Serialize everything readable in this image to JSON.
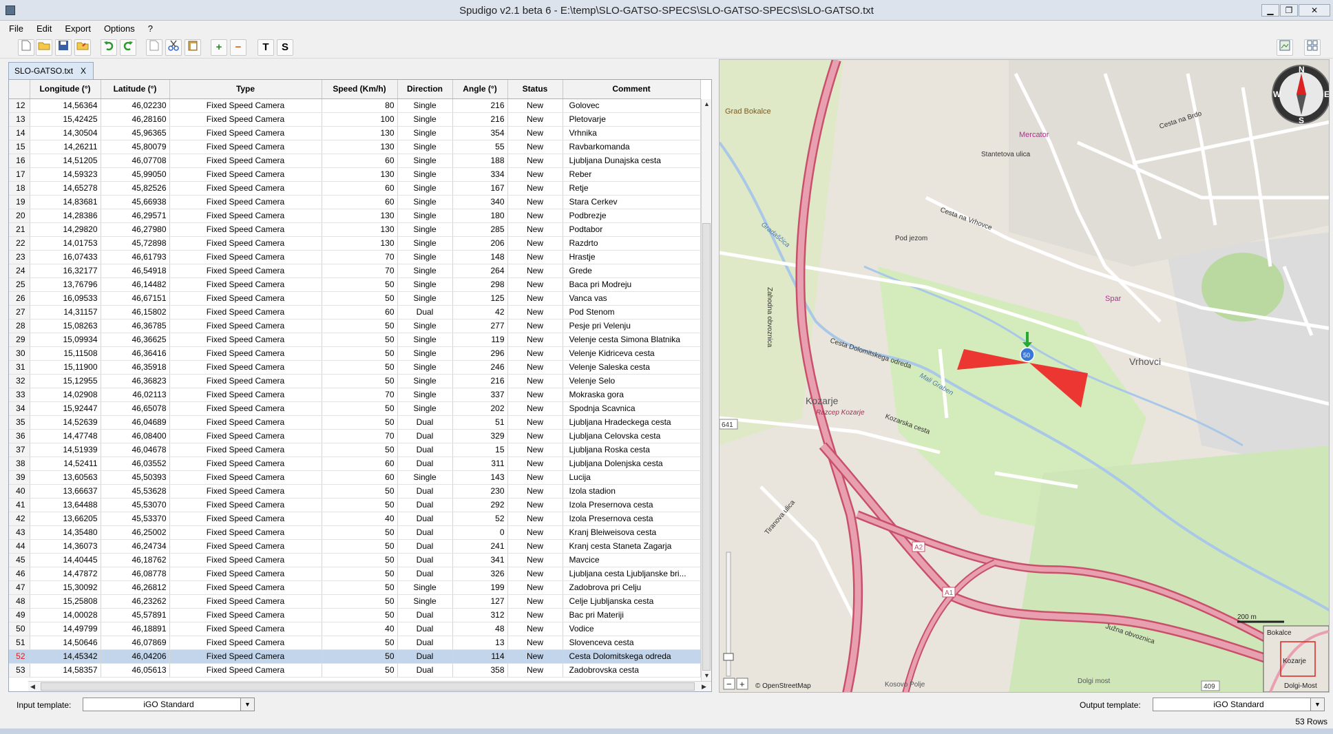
{
  "window": {
    "title": "Spudigo v2.1 beta 6 - E:\\temp\\SLO-GATSO-SPECS\\SLO-GATSO-SPECS\\SLO-GATSO.txt",
    "minimize": "▁",
    "maximize": "❐",
    "close": "✕"
  },
  "menu": [
    "File",
    "Edit",
    "Export",
    "Options",
    "?"
  ],
  "toolbar": {
    "text_tool": "T",
    "speed_tool": "S",
    "add": "+",
    "remove": "−"
  },
  "tab": {
    "label": "SLO-GATSO.txt",
    "close": "X"
  },
  "table": {
    "columns": [
      "",
      "Longitude (°)",
      "Latitude (°)",
      "Type",
      "Speed (Km/h)",
      "Direction",
      "Angle (°)",
      "Status",
      "Comment"
    ],
    "rows": [
      [
        "12",
        "14,56364",
        "46,02230",
        "Fixed Speed Camera",
        "80",
        "Single",
        "216",
        "New",
        "Golovec"
      ],
      [
        "13",
        "15,42425",
        "46,28160",
        "Fixed Speed Camera",
        "100",
        "Single",
        "216",
        "New",
        "Pletovarje"
      ],
      [
        "14",
        "14,30504",
        "45,96365",
        "Fixed Speed Camera",
        "130",
        "Single",
        "354",
        "New",
        "Vrhnika"
      ],
      [
        "15",
        "14,26211",
        "45,80079",
        "Fixed Speed Camera",
        "130",
        "Single",
        "55",
        "New",
        "Ravbarkomanda"
      ],
      [
        "16",
        "14,51205",
        "46,07708",
        "Fixed Speed Camera",
        "60",
        "Single",
        "188",
        "New",
        "Ljubljana Dunajska cesta"
      ],
      [
        "17",
        "14,59323",
        "45,99050",
        "Fixed Speed Camera",
        "130",
        "Single",
        "334",
        "New",
        "Reber"
      ],
      [
        "18",
        "14,65278",
        "45,82526",
        "Fixed Speed Camera",
        "60",
        "Single",
        "167",
        "New",
        "Retje"
      ],
      [
        "19",
        "14,83681",
        "45,66938",
        "Fixed Speed Camera",
        "60",
        "Single",
        "340",
        "New",
        "Stara Cerkev"
      ],
      [
        "20",
        "14,28386",
        "46,29571",
        "Fixed Speed Camera",
        "130",
        "Single",
        "180",
        "New",
        "Podbrezje"
      ],
      [
        "21",
        "14,29820",
        "46,27980",
        "Fixed Speed Camera",
        "130",
        "Single",
        "285",
        "New",
        "Podtabor"
      ],
      [
        "22",
        "14,01753",
        "45,72898",
        "Fixed Speed Camera",
        "130",
        "Single",
        "206",
        "New",
        "Razdrto"
      ],
      [
        "23",
        "16,07433",
        "46,61793",
        "Fixed Speed Camera",
        "70",
        "Single",
        "148",
        "New",
        "Hrastje"
      ],
      [
        "24",
        "16,32177",
        "46,54918",
        "Fixed Speed Camera",
        "70",
        "Single",
        "264",
        "New",
        "Grede"
      ],
      [
        "25",
        "13,76796",
        "46,14482",
        "Fixed Speed Camera",
        "50",
        "Single",
        "298",
        "New",
        "Baca pri Modreju"
      ],
      [
        "26",
        "16,09533",
        "46,67151",
        "Fixed Speed Camera",
        "50",
        "Single",
        "125",
        "New",
        "Vanca vas"
      ],
      [
        "27",
        "14,31157",
        "46,15802",
        "Fixed Speed Camera",
        "60",
        "Dual",
        "42",
        "New",
        "Pod Stenom"
      ],
      [
        "28",
        "15,08263",
        "46,36785",
        "Fixed Speed Camera",
        "50",
        "Single",
        "277",
        "New",
        "Pesje pri Velenju"
      ],
      [
        "29",
        "15,09934",
        "46,36625",
        "Fixed Speed Camera",
        "50",
        "Single",
        "119",
        "New",
        "Velenje cesta Simona Blatnika"
      ],
      [
        "30",
        "15,11508",
        "46,36416",
        "Fixed Speed Camera",
        "50",
        "Single",
        "296",
        "New",
        "Velenje Kidriceva cesta"
      ],
      [
        "31",
        "15,11900",
        "46,35918",
        "Fixed Speed Camera",
        "50",
        "Single",
        "246",
        "New",
        "Velenje Saleska cesta"
      ],
      [
        "32",
        "15,12955",
        "46,36823",
        "Fixed Speed Camera",
        "50",
        "Single",
        "216",
        "New",
        "Velenje Selo"
      ],
      [
        "33",
        "14,02908",
        "46,02113",
        "Fixed Speed Camera",
        "70",
        "Single",
        "337",
        "New",
        "Mokraska gora"
      ],
      [
        "34",
        "15,92447",
        "46,65078",
        "Fixed Speed Camera",
        "50",
        "Single",
        "202",
        "New",
        "Spodnja Scavnica"
      ],
      [
        "35",
        "14,52639",
        "46,04689",
        "Fixed Speed Camera",
        "50",
        "Dual",
        "51",
        "New",
        "Ljubljana Hradeckega cesta"
      ],
      [
        "36",
        "14,47748",
        "46,08400",
        "Fixed Speed Camera",
        "70",
        "Dual",
        "329",
        "New",
        "Ljubljana Celovska cesta"
      ],
      [
        "37",
        "14,51939",
        "46,04678",
        "Fixed Speed Camera",
        "50",
        "Dual",
        "15",
        "New",
        "Ljubljana Roska cesta"
      ],
      [
        "38",
        "14,52411",
        "46,03552",
        "Fixed Speed Camera",
        "60",
        "Dual",
        "311",
        "New",
        "Ljubljana Dolenjska cesta"
      ],
      [
        "39",
        "13,60563",
        "45,50393",
        "Fixed Speed Camera",
        "60",
        "Single",
        "143",
        "New",
        "Lucija"
      ],
      [
        "40",
        "13,66637",
        "45,53628",
        "Fixed Speed Camera",
        "50",
        "Dual",
        "230",
        "New",
        "Izola stadion"
      ],
      [
        "41",
        "13,64488",
        "45,53070",
        "Fixed Speed Camera",
        "50",
        "Dual",
        "292",
        "New",
        "Izola Presernova cesta"
      ],
      [
        "42",
        "13,66205",
        "45,53370",
        "Fixed Speed Camera",
        "40",
        "Dual",
        "52",
        "New",
        "Izola Presernova cesta"
      ],
      [
        "43",
        "14,35480",
        "46,25002",
        "Fixed Speed Camera",
        "50",
        "Dual",
        "0",
        "New",
        "Kranj Bleiweisova cesta"
      ],
      [
        "44",
        "14,36073",
        "46,24734",
        "Fixed Speed Camera",
        "50",
        "Dual",
        "241",
        "New",
        "Kranj cesta Staneta Zagarja"
      ],
      [
        "45",
        "14,40445",
        "46,18762",
        "Fixed Speed Camera",
        "50",
        "Dual",
        "341",
        "New",
        "Mavcice"
      ],
      [
        "46",
        "14,47872",
        "46,08778",
        "Fixed Speed Camera",
        "50",
        "Dual",
        "326",
        "New",
        "Ljubljana cesta Ljubljanske bri..."
      ],
      [
        "47",
        "15,30092",
        "46,26812",
        "Fixed Speed Camera",
        "50",
        "Single",
        "199",
        "New",
        "Zadobrova pri Celju"
      ],
      [
        "48",
        "15,25808",
        "46,23262",
        "Fixed Speed Camera",
        "50",
        "Single",
        "127",
        "New",
        "Celje Ljubljanska cesta"
      ],
      [
        "49",
        "14,00028",
        "45,57891",
        "Fixed Speed Camera",
        "50",
        "Dual",
        "312",
        "New",
        "Bac pri Materiji"
      ],
      [
        "50",
        "14,49799",
        "46,18891",
        "Fixed Speed Camera",
        "40",
        "Dual",
        "48",
        "New",
        "Vodice"
      ],
      [
        "51",
        "14,50646",
        "46,07869",
        "Fixed Speed Camera",
        "50",
        "Dual",
        "13",
        "New",
        "Slovenceva cesta"
      ],
      [
        "52",
        "14,45342",
        "46,04206",
        "Fixed Speed Camera",
        "50",
        "Dual",
        "114",
        "New",
        "Cesta Dolomitskega odreda"
      ],
      [
        "53",
        "14,58357",
        "46,05613",
        "Fixed Speed Camera",
        "50",
        "Dual",
        "358",
        "New",
        "Zadobrovska cesta"
      ]
    ],
    "selected_row": "52"
  },
  "map": {
    "labels": {
      "kozarje": "Kozarje",
      "vrhovci": "Vrhovci",
      "grad_bokalce": "Grad Bokalce",
      "mercator": "Mercator",
      "spar": "Spar",
      "razcep_kozarje": "Razcep Kozarje",
      "zahodna_obvoznica": "Zahodna obvoznica",
      "juzna_obvoznica": "Južna obvoznica",
      "cesta_dolomitskega": "Cesta Dolomitskega odreda",
      "mali_graben": "Mali Graben",
      "gradascica": "Gradaščica",
      "cesta_na_vrhovce": "Cesta na Vrhovce",
      "pod_jezom": "Pod jezom",
      "kozarska": "Kozarska cesta",
      "tiranova": "Tiranova ulica",
      "a1": "A1",
      "a2": "A2",
      "n641": "641",
      "n409": "409",
      "kosovo": "Kosovo Polje",
      "dolgi_most": "Dolgi most",
      "stantetova": "Stantetova ulica",
      "cesta_na_brdo": "Cesta na Brdo"
    },
    "camera_speed": "50",
    "osm": "© OpenStreetMap",
    "scale": "200 m",
    "compass": {
      "n": "N",
      "s": "S",
      "e": "E",
      "w": "W"
    },
    "zoom_in": "+",
    "zoom_out": "−",
    "minimap": {
      "top": "Bokalce",
      "mid": "Kozarje",
      "bottom": "Dolgi-Most"
    }
  },
  "footer": {
    "input_label": "Input template:",
    "input_value": "iGO Standard",
    "output_label": "Output template:",
    "output_value": "iGO Standard",
    "row_count": "53 Rows"
  }
}
